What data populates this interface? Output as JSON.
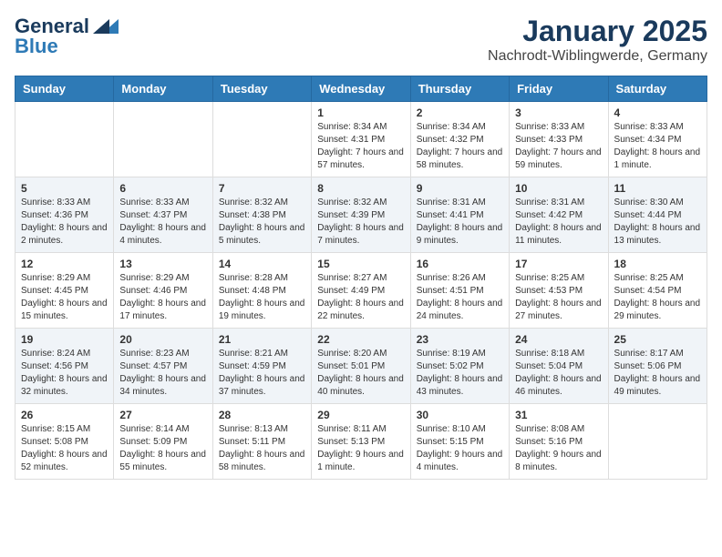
{
  "logo": {
    "line1": "General",
    "line2": "Blue"
  },
  "title": "January 2025",
  "subtitle": "Nachrodt-Wiblingwerde, Germany",
  "days_of_week": [
    "Sunday",
    "Monday",
    "Tuesday",
    "Wednesday",
    "Thursday",
    "Friday",
    "Saturday"
  ],
  "weeks": [
    [
      {
        "day": "",
        "content": ""
      },
      {
        "day": "",
        "content": ""
      },
      {
        "day": "",
        "content": ""
      },
      {
        "day": "1",
        "content": "Sunrise: 8:34 AM\nSunset: 4:31 PM\nDaylight: 7 hours and 57 minutes."
      },
      {
        "day": "2",
        "content": "Sunrise: 8:34 AM\nSunset: 4:32 PM\nDaylight: 7 hours and 58 minutes."
      },
      {
        "day": "3",
        "content": "Sunrise: 8:33 AM\nSunset: 4:33 PM\nDaylight: 7 hours and 59 minutes."
      },
      {
        "day": "4",
        "content": "Sunrise: 8:33 AM\nSunset: 4:34 PM\nDaylight: 8 hours and 1 minute."
      }
    ],
    [
      {
        "day": "5",
        "content": "Sunrise: 8:33 AM\nSunset: 4:36 PM\nDaylight: 8 hours and 2 minutes."
      },
      {
        "day": "6",
        "content": "Sunrise: 8:33 AM\nSunset: 4:37 PM\nDaylight: 8 hours and 4 minutes."
      },
      {
        "day": "7",
        "content": "Sunrise: 8:32 AM\nSunset: 4:38 PM\nDaylight: 8 hours and 5 minutes."
      },
      {
        "day": "8",
        "content": "Sunrise: 8:32 AM\nSunset: 4:39 PM\nDaylight: 8 hours and 7 minutes."
      },
      {
        "day": "9",
        "content": "Sunrise: 8:31 AM\nSunset: 4:41 PM\nDaylight: 8 hours and 9 minutes."
      },
      {
        "day": "10",
        "content": "Sunrise: 8:31 AM\nSunset: 4:42 PM\nDaylight: 8 hours and 11 minutes."
      },
      {
        "day": "11",
        "content": "Sunrise: 8:30 AM\nSunset: 4:44 PM\nDaylight: 8 hours and 13 minutes."
      }
    ],
    [
      {
        "day": "12",
        "content": "Sunrise: 8:29 AM\nSunset: 4:45 PM\nDaylight: 8 hours and 15 minutes."
      },
      {
        "day": "13",
        "content": "Sunrise: 8:29 AM\nSunset: 4:46 PM\nDaylight: 8 hours and 17 minutes."
      },
      {
        "day": "14",
        "content": "Sunrise: 8:28 AM\nSunset: 4:48 PM\nDaylight: 8 hours and 19 minutes."
      },
      {
        "day": "15",
        "content": "Sunrise: 8:27 AM\nSunset: 4:49 PM\nDaylight: 8 hours and 22 minutes."
      },
      {
        "day": "16",
        "content": "Sunrise: 8:26 AM\nSunset: 4:51 PM\nDaylight: 8 hours and 24 minutes."
      },
      {
        "day": "17",
        "content": "Sunrise: 8:25 AM\nSunset: 4:53 PM\nDaylight: 8 hours and 27 minutes."
      },
      {
        "day": "18",
        "content": "Sunrise: 8:25 AM\nSunset: 4:54 PM\nDaylight: 8 hours and 29 minutes."
      }
    ],
    [
      {
        "day": "19",
        "content": "Sunrise: 8:24 AM\nSunset: 4:56 PM\nDaylight: 8 hours and 32 minutes."
      },
      {
        "day": "20",
        "content": "Sunrise: 8:23 AM\nSunset: 4:57 PM\nDaylight: 8 hours and 34 minutes."
      },
      {
        "day": "21",
        "content": "Sunrise: 8:21 AM\nSunset: 4:59 PM\nDaylight: 8 hours and 37 minutes."
      },
      {
        "day": "22",
        "content": "Sunrise: 8:20 AM\nSunset: 5:01 PM\nDaylight: 8 hours and 40 minutes."
      },
      {
        "day": "23",
        "content": "Sunrise: 8:19 AM\nSunset: 5:02 PM\nDaylight: 8 hours and 43 minutes."
      },
      {
        "day": "24",
        "content": "Sunrise: 8:18 AM\nSunset: 5:04 PM\nDaylight: 8 hours and 46 minutes."
      },
      {
        "day": "25",
        "content": "Sunrise: 8:17 AM\nSunset: 5:06 PM\nDaylight: 8 hours and 49 minutes."
      }
    ],
    [
      {
        "day": "26",
        "content": "Sunrise: 8:15 AM\nSunset: 5:08 PM\nDaylight: 8 hours and 52 minutes."
      },
      {
        "day": "27",
        "content": "Sunrise: 8:14 AM\nSunset: 5:09 PM\nDaylight: 8 hours and 55 minutes."
      },
      {
        "day": "28",
        "content": "Sunrise: 8:13 AM\nSunset: 5:11 PM\nDaylight: 8 hours and 58 minutes."
      },
      {
        "day": "29",
        "content": "Sunrise: 8:11 AM\nSunset: 5:13 PM\nDaylight: 9 hours and 1 minute."
      },
      {
        "day": "30",
        "content": "Sunrise: 8:10 AM\nSunset: 5:15 PM\nDaylight: 9 hours and 4 minutes."
      },
      {
        "day": "31",
        "content": "Sunrise: 8:08 AM\nSunset: 5:16 PM\nDaylight: 9 hours and 8 minutes."
      },
      {
        "day": "",
        "content": ""
      }
    ]
  ]
}
